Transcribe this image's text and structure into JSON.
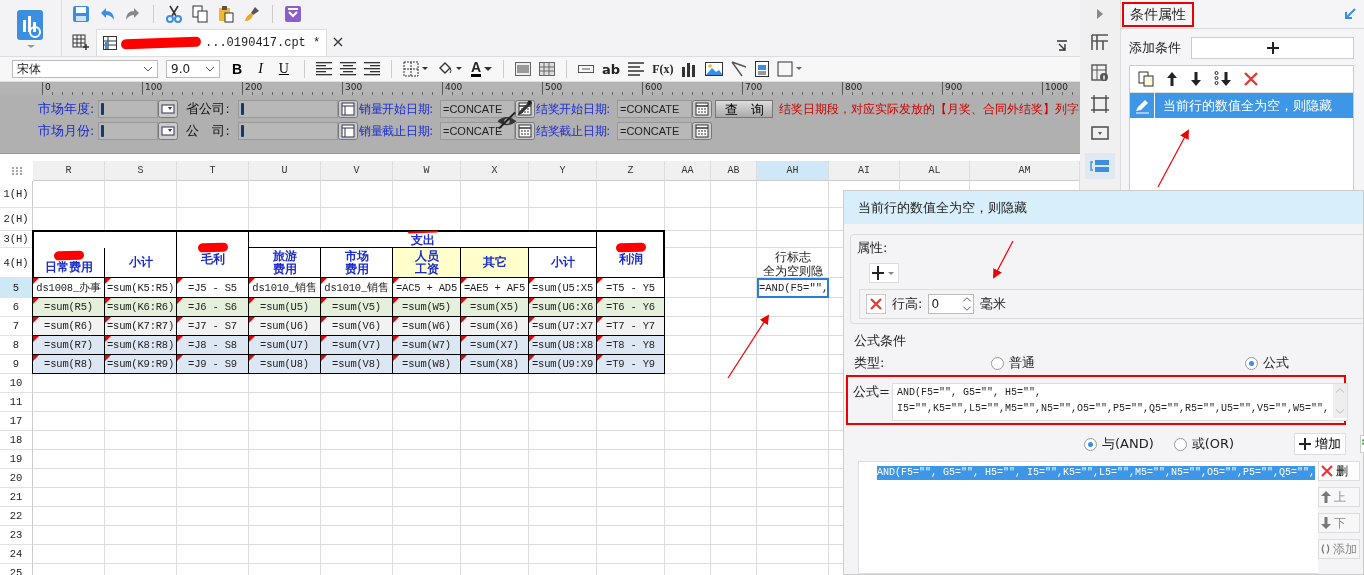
{
  "quick_toolbar": {
    "tab": {
      "title": "...0190417.cpt *",
      "redacted": true,
      "selected": true
    }
  },
  "format_toolbar": {
    "font": "宋体",
    "size": "9.0",
    "style_buttons": [
      "B",
      "I",
      "U"
    ],
    "font_color_label": "A",
    "text_tool_label": "ab",
    "formula_label": "F(x)"
  },
  "ruler": [
    "0",
    "100",
    "200",
    "300",
    "400",
    "500",
    "600",
    "700",
    "800",
    "900",
    "1000"
  ],
  "parameters": {
    "rows": [
      {
        "fields": [
          {
            "label": "市场年度:",
            "kind": "dropdown"
          },
          {
            "label": "省公司:",
            "kind": "tree"
          },
          {
            "label": "销量开始日期:",
            "value": "=CONCATE",
            "kind": "calendar"
          },
          {
            "label": "结奖开始日期:",
            "value": "=CONCATE",
            "kind": "calendar"
          }
        ]
      },
      {
        "fields": [
          {
            "label": "市场月份:",
            "kind": "dropdown"
          },
          {
            "label": "公　司:",
            "kind": "tree"
          },
          {
            "label": "销量截止日期:",
            "value": "=CONCATE",
            "kind": "calendar"
          },
          {
            "label": "结奖截止日期:",
            "value": "=CONCATE",
            "kind": "calendar"
          }
        ]
      }
    ],
    "query_button": "查　询",
    "note": "结奖日期段，对应实际发放的【月奖、合同外结奖】列字"
  },
  "sheet": {
    "columns": [
      {
        "label": "R",
        "selected": false
      },
      {
        "label": "S",
        "selected": false
      },
      {
        "label": "T",
        "selected": false
      },
      {
        "label": "U",
        "selected": false
      },
      {
        "label": "V",
        "selected": false
      },
      {
        "label": "W",
        "selected": false
      },
      {
        "label": "X",
        "selected": false
      },
      {
        "label": "Y",
        "selected": false
      },
      {
        "label": "Z",
        "selected": false
      },
      {
        "label": "AA",
        "selected": false
      },
      {
        "label": "AB",
        "selected": false
      },
      {
        "label": "AH",
        "selected": true
      },
      {
        "label": "AI",
        "selected": false
      },
      {
        "label": "AL",
        "selected": false
      },
      {
        "label": "AM",
        "selected": false
      }
    ],
    "row_labels": [
      {
        "label": "1(H)",
        "selected": false
      },
      {
        "label": "2(H)",
        "selected": false
      },
      {
        "label": "3(H)",
        "selected": false
      },
      {
        "label": "4(H)",
        "selected": false
      },
      {
        "label": "5",
        "selected": true
      },
      {
        "label": "6",
        "selected": false
      },
      {
        "label": "7",
        "selected": false
      },
      {
        "label": "8",
        "selected": false
      },
      {
        "label": "9",
        "selected": false
      },
      {
        "label": "10",
        "selected": false
      },
      {
        "label": "11",
        "selected": false
      },
      {
        "label": "17",
        "selected": false
      },
      {
        "label": "18",
        "selected": false
      },
      {
        "label": "19",
        "selected": false
      },
      {
        "label": "20",
        "selected": false
      },
      {
        "label": "21",
        "selected": false
      },
      {
        "label": "22",
        "selected": false
      },
      {
        "label": "23",
        "selected": false
      },
      {
        "label": "24",
        "selected": false
      },
      {
        "label": "25",
        "selected": false
      }
    ],
    "header_cells": [
      {
        "kind": "header",
        "lines": [
          "支出"
        ],
        "redacted": true,
        "highlighted": false
      },
      {
        "kind": "header",
        "lines": [
          "日常费用"
        ],
        "redacted": true,
        "highlighted": false
      },
      {
        "kind": "header",
        "lines": [
          "小计"
        ],
        "redacted": false,
        "highlighted": false
      },
      {
        "kind": "header",
        "lines": [
          "毛利"
        ],
        "redacted": true,
        "highlighted": false
      },
      {
        "kind": "header",
        "lines": [
          "旅游",
          "费用"
        ],
        "redacted": false,
        "highlighted": false
      },
      {
        "kind": "header",
        "lines": [
          "市场",
          "费用"
        ],
        "redacted": false,
        "highlighted": false
      },
      {
        "kind": "header",
        "lines": [
          "人员",
          "工资"
        ],
        "redacted": false,
        "highlighted": true
      },
      {
        "kind": "header",
        "lines": [
          "其它"
        ],
        "redacted": false,
        "highlighted": true
      },
      {
        "kind": "header",
        "lines": [
          "小计"
        ],
        "redacted": false,
        "highlighted": false
      },
      {
        "kind": "header",
        "lines": [
          "利润"
        ],
        "redacted": true,
        "highlighted": false
      },
      {
        "kind": "plain",
        "lines": [
          "行标志",
          "全为空则隐"
        ]
      }
    ],
    "rows": [
      {
        "color": "#ffffff",
        "cells": [
          "ds1008_办事",
          "=sum(K5:R5)",
          "=J5 - S5",
          "ds1010_销售",
          "ds1010_销售",
          "=AC5 + AD5",
          "=AE5 + AF5",
          "=sum(U5:X5",
          "=T5 - Y5"
        ]
      },
      {
        "color": "#e4f0dc",
        "cells": [
          "=sum(R5)",
          "=sum(K6:R6)",
          "=J6 - S6",
          "=sum(U5)",
          "=sum(V5)",
          "=sum(W5)",
          "=sum(X5)",
          "=sum(U6:X6",
          "=T6 - Y6"
        ]
      },
      {
        "color": "#f2f2f2",
        "cells": [
          "=sum(R6)",
          "=sum(K7:R7)",
          "=J7 - S7",
          "=sum(U6)",
          "=sum(V6)",
          "=sum(W6)",
          "=sum(X6)",
          "=sum(U7:X7",
          "=T7 - Y7"
        ]
      },
      {
        "color": "#dde7f3",
        "cells": [
          "=sum(R7)",
          "=sum(K8:R8)",
          "=J8 - S8",
          "=sum(U7)",
          "=sum(V7)",
          "=sum(W7)",
          "=sum(X7)",
          "=sum(U8:X8",
          "=T8 - Y8"
        ]
      },
      {
        "color": "#dde7f3",
        "cells": [
          "=sum(R8)",
          "=sum(K9:R9)",
          "=J9 - S9",
          "=sum(U8)",
          "=sum(V8)",
          "=sum(W8)",
          "=sum(X8)",
          "=sum(U9:X9",
          "=T9 - Y9"
        ]
      }
    ],
    "flag_cell": {
      "text": "=AND(F5=\"\",",
      "selected": true
    }
  },
  "side_panel": {
    "title": "条件属性",
    "add_label": "添加条件",
    "conditions": [
      {
        "text": "当前行的数值全为空，则隐藏",
        "selected": true
      }
    ]
  },
  "dialog": {
    "title": "当前行的数值全为空，则隐藏",
    "attributes_label": "属性:",
    "row_height_label": "行高:",
    "row_height_value": "0",
    "unit": "毫米",
    "condition_group": "公式条件",
    "type_label": "类型:",
    "types": [
      {
        "label": "普通",
        "selected": false
      },
      {
        "label": "公式",
        "selected": true
      }
    ],
    "formula_label": "公式=",
    "formula": "AND(F5=\"\", G5=\"\", H5=\"\",\nI5=\"\",K5=\"\",L5=\"\",M5=\"\",N5=\"\",O5=\"\",P5=\"\",Q5=\"\",R5=\"\",U5=\"\",V5=\"\",W5=\"\",",
    "logic": [
      {
        "label": "与(AND)",
        "selected": true
      },
      {
        "label": "或(OR)",
        "selected": false
      }
    ],
    "add_button": "增加",
    "list_items": [
      {
        "text": "AND(F5=\"\", G5=\"\", H5=\"\", I5=\"\",K5=\"\",L5=\"\",M5=\"\",N5=\"\",O5=\"\",P5=\"\",Q5=\"\",",
        "selected": true
      }
    ],
    "side_buttons": [
      {
        "label": "删",
        "kind": "delete"
      },
      {
        "label": "上",
        "kind": "up"
      },
      {
        "label": "下",
        "kind": "down"
      },
      {
        "label": "添加",
        "kind": "bracket"
      }
    ]
  }
}
